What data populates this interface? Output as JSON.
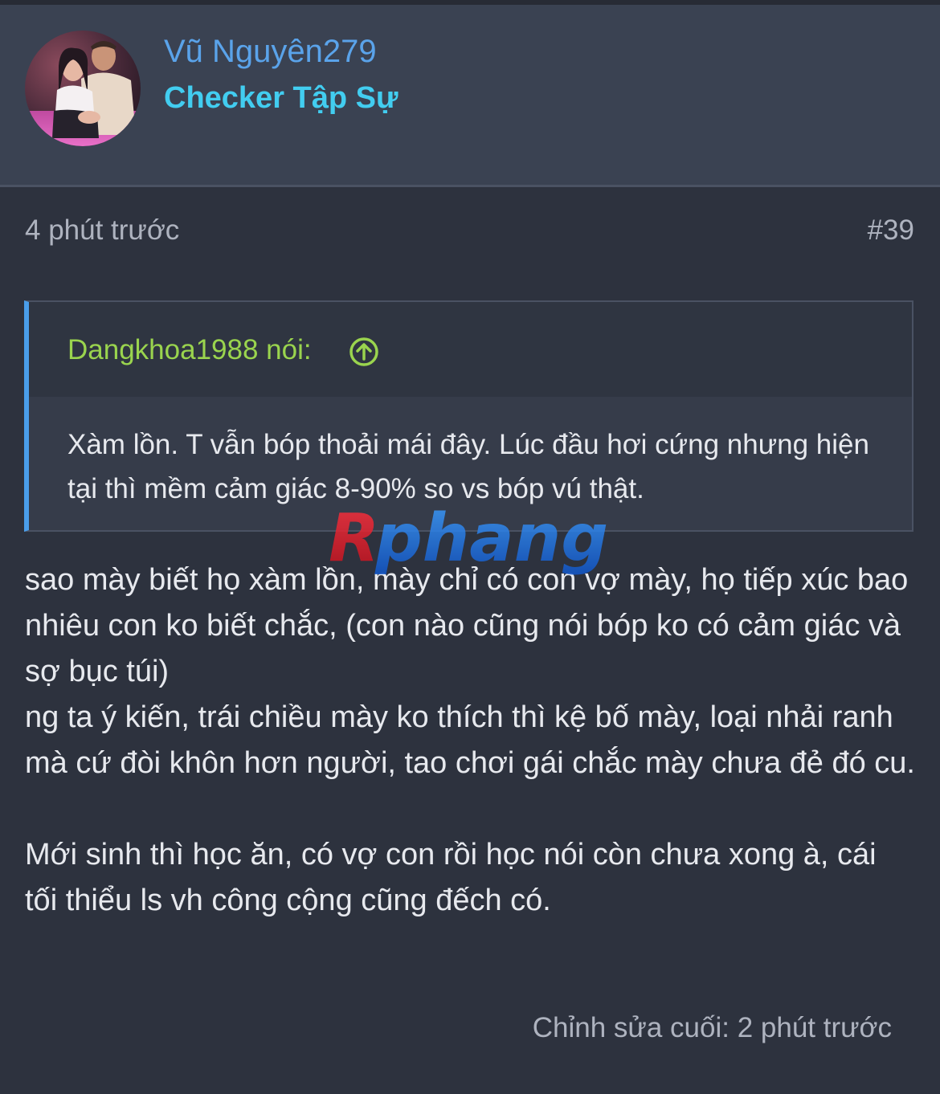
{
  "post": {
    "author": {
      "username": "Vũ Nguyên279",
      "title": "Checker Tập Sự",
      "avatar_icon": "user-avatar-photo"
    },
    "time": "4 phút trước",
    "number": "#39",
    "quote": {
      "author_label": "Dangkhoa1988 nói:",
      "jump_icon": "arrow-up-circle-icon",
      "text": "Xàm lồn. T vẫn bóp thoải mái đây. Lúc đầu hơi cứng nhưng hiện tại thì mềm cảm giác 8-90% so vs bóp vú thật."
    },
    "paragraphs": [
      "sao mày biết họ xàm lồn, mày chỉ có con vợ mày, họ tiếp xúc bao nhiêu con ko biết chắc, (con nào cũng nói bóp ko có cảm giác và sợ bục túi)\nng ta ý kiến, trái chiều mày ko thích thì kệ bố mày, loại nhải ranh mà cứ đòi khôn hơn người, tao chơi gái chắc mày chưa đẻ đó cu.",
      "Mới sinh thì học ăn, có vợ con rồi học nói còn chưa xong à, cái tối thiểu ls vh công cộng cũng đếch có."
    ],
    "last_edited": "Chỉnh sửa cuối: 2 phút trước"
  },
  "watermark": {
    "text": "Rphang"
  },
  "colors": {
    "background": "#2d323e",
    "header": "#3a4252",
    "username": "#5aa3ea",
    "user_title": "#42cdf0",
    "quote_author": "#9ad44e",
    "quote_border": "#4a9eea",
    "muted_text": "#aeb3bf"
  }
}
